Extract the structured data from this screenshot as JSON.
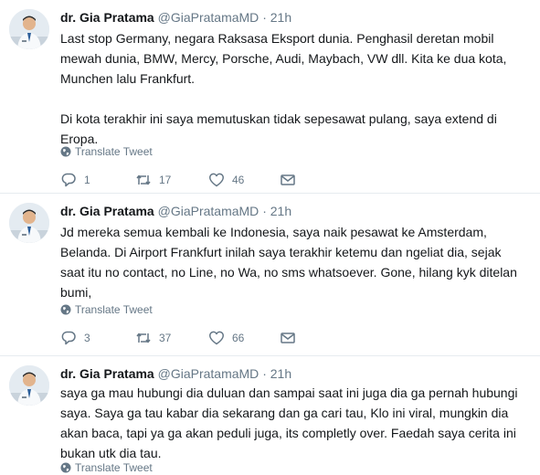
{
  "tweets": [
    {
      "name": "dr. Gia Pratama",
      "handle": "@GiaPratamaMD",
      "separator": "·",
      "time": "21h",
      "paragraphs": [
        "Last stop Germany, negara Raksasa Eksport dunia. Penghasil deretan mobil mewah dunia, BMW, Mercy, Porsche, Audi, Maybach, VW dll. Kita ke dua kota, Munchen lalu Frankfurt.",
        "Di kota terakhir ini saya memutuskan tidak sepesawat pulang, saya extend di Eropa."
      ],
      "translate_label": "Translate Tweet",
      "replies": "1",
      "retweets": "17",
      "likes": "46"
    },
    {
      "name": "dr. Gia Pratama",
      "handle": "@GiaPratamaMD",
      "separator": "·",
      "time": "21h",
      "paragraphs": [
        "Jd mereka semua kembali ke Indonesia, saya naik pesawat ke Amsterdam, Belanda. Di Airport Frankfurt inilah saya terakhir ketemu dan ngeliat dia, sejak saat itu no contact, no Line, no Wa, no sms whatsoever. Gone, hilang kyk ditelan bumi,"
      ],
      "translate_label": "Translate Tweet",
      "replies": "3",
      "retweets": "37",
      "likes": "66"
    },
    {
      "name": "dr. Gia Pratama",
      "handle": "@GiaPratamaMD",
      "separator": "·",
      "time": "21h",
      "paragraphs": [
        "saya ga mau hubungi dia duluan dan sampai saat ini juga dia ga pernah hubungi saya. Saya ga tau kabar dia sekarang dan ga cari tau, Klo ini viral, mungkin dia akan baca, tapi ya ga akan peduli juga, its completly over. Faedah saya cerita ini bukan utk dia tau."
      ],
      "translate_label": "Translate Tweet"
    }
  ],
  "icons": {
    "reply": "reply-icon",
    "retweet": "retweet-icon",
    "like": "heart-icon",
    "message": "envelope-icon",
    "translate": "globe-icon"
  },
  "colors": {
    "text": "#14171a",
    "secondary": "#657786",
    "divider": "#e6ecf0"
  }
}
